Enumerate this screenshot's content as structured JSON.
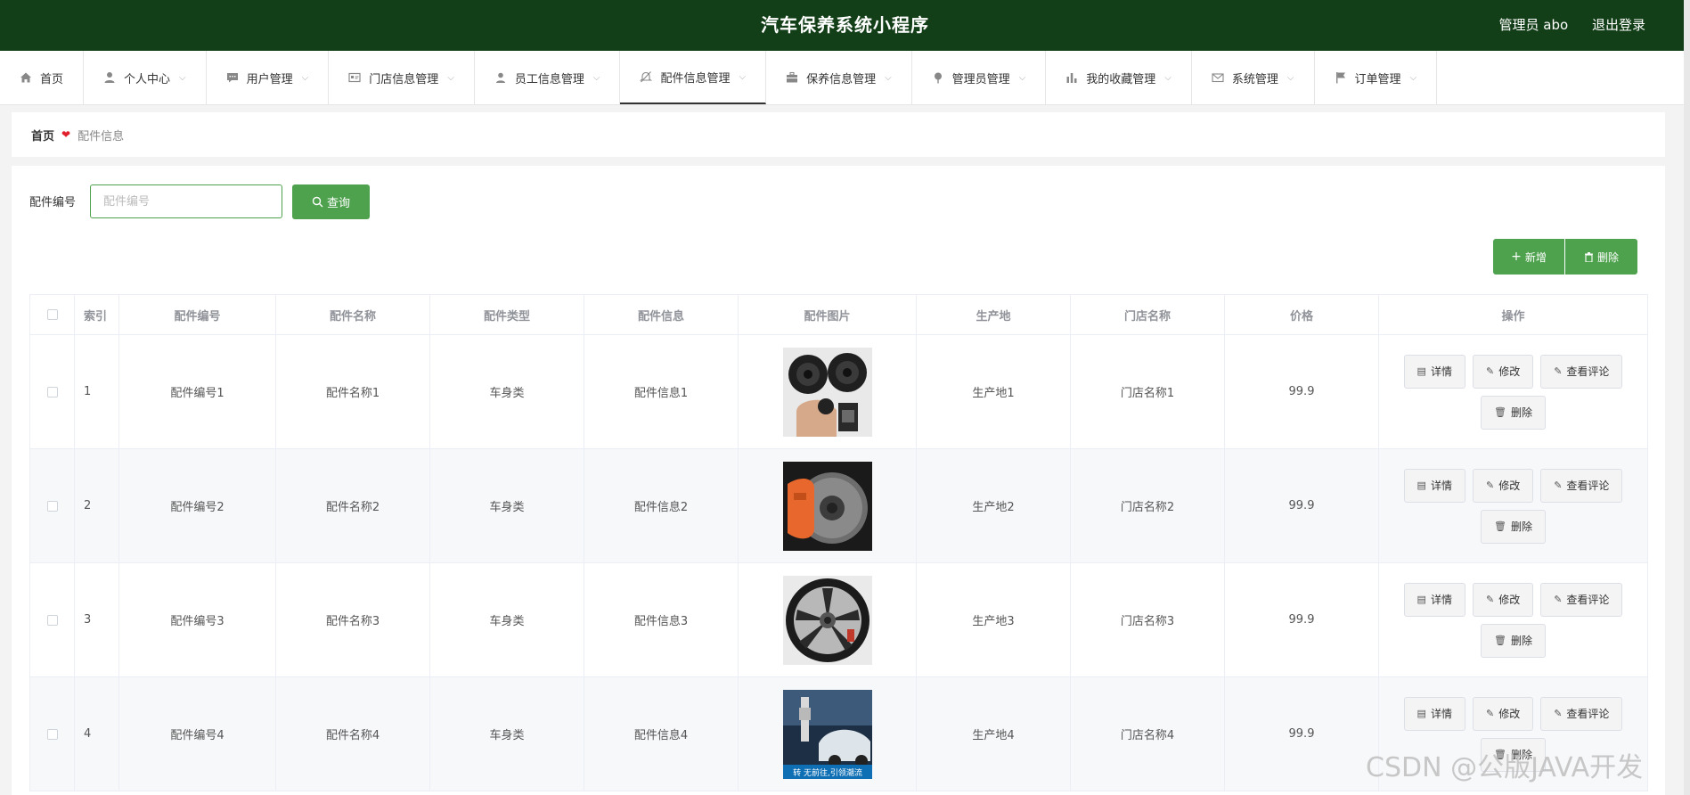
{
  "header": {
    "app_title": "汽车保养系统小程序",
    "user_label": "管理员 abo",
    "logout_label": "退出登录"
  },
  "nav": {
    "items": [
      {
        "label": "首页",
        "icon": "home-icon",
        "has_chevron": false,
        "active": false
      },
      {
        "label": "个人中心",
        "icon": "person-icon",
        "has_chevron": true,
        "active": false
      },
      {
        "label": "用户管理",
        "icon": "chat-icon",
        "has_chevron": true,
        "active": false
      },
      {
        "label": "门店信息管理",
        "icon": "card-icon",
        "has_chevron": true,
        "active": false
      },
      {
        "label": "员工信息管理",
        "icon": "user-icon",
        "has_chevron": true,
        "active": false
      },
      {
        "label": "配件信息管理",
        "icon": "bell-off-icon",
        "has_chevron": true,
        "active": true
      },
      {
        "label": "保养信息管理",
        "icon": "briefcase-icon",
        "has_chevron": true,
        "active": false
      },
      {
        "label": "管理员管理",
        "icon": "pin-icon",
        "has_chevron": true,
        "active": false
      },
      {
        "label": "我的收藏管理",
        "icon": "bar-chart-icon",
        "has_chevron": true,
        "active": false
      },
      {
        "label": "系统管理",
        "icon": "mail-icon",
        "has_chevron": true,
        "active": false
      },
      {
        "label": "订单管理",
        "icon": "flag-icon",
        "has_chevron": true,
        "active": false
      }
    ]
  },
  "breadcrumb": {
    "home": "首页",
    "current": "配件信息"
  },
  "search": {
    "label": "配件编号",
    "placeholder": "配件编号",
    "value": "",
    "button_label": "查询"
  },
  "actions": {
    "add_label": "新增",
    "delete_label": "删除"
  },
  "table": {
    "columns": [
      "索引",
      "配件编号",
      "配件名称",
      "配件类型",
      "配件信息",
      "配件图片",
      "生产地",
      "门店名称",
      "价格",
      "操作"
    ],
    "rows": [
      {
        "index": "1",
        "code": "配件编号1",
        "name": "配件名称1",
        "type": "车身类",
        "info": "配件信息1",
        "image": "speakers",
        "place": "生产地1",
        "store": "门店名称1",
        "price": "99.9"
      },
      {
        "index": "2",
        "code": "配件编号2",
        "name": "配件名称2",
        "type": "车身类",
        "info": "配件信息2",
        "image": "brake-caliper",
        "place": "生产地2",
        "store": "门店名称2",
        "price": "99.9"
      },
      {
        "index": "3",
        "code": "配件编号3",
        "name": "配件名称3",
        "type": "车身类",
        "info": "配件信息3",
        "image": "alloy-wheel",
        "place": "生产地3",
        "store": "门店名称3",
        "price": "99.9"
      },
      {
        "index": "4",
        "code": "配件编号4",
        "name": "配件名称4",
        "type": "车身类",
        "info": "配件信息4",
        "image": "spark-plug-ad",
        "place": "生产地4",
        "store": "门店名称4",
        "price": "99.9"
      }
    ],
    "row_actions": {
      "detail": "详情",
      "edit": "修改",
      "view_comments": "查看评论",
      "delete": "删除"
    }
  },
  "image_captions": {
    "spark_plug_ad": "转 无前往,引领潮流"
  },
  "watermark": "CSDN @公版JAVA开发",
  "colors": {
    "header_bg": "#133f18",
    "accent": "#4ea24e",
    "breadcrumb_heart": "#e0202a"
  }
}
